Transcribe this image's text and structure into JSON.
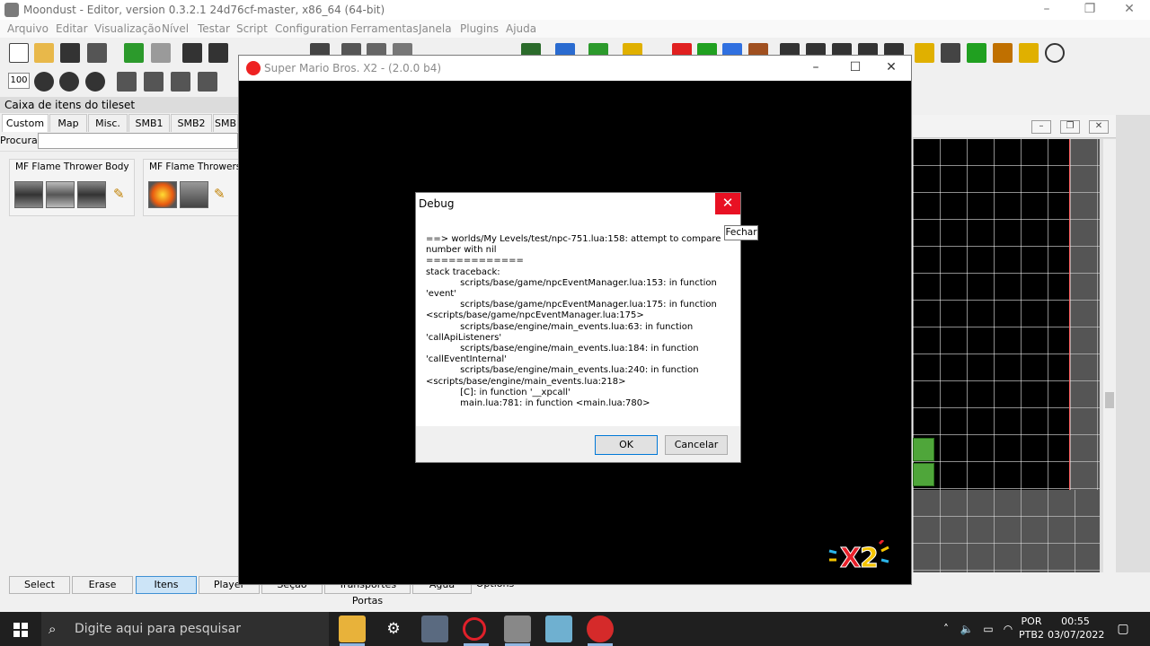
{
  "editor": {
    "title": "Moondust - Editor, version 0.3.2.1 24d76cf-master, x86_64 (64-bit)",
    "menu": [
      "Arquivo",
      "Editar",
      "Visualização",
      "Nível",
      "Testar",
      "Script",
      "Configuration",
      "Ferramentas",
      "Janela",
      "Plugins",
      "Ajuda"
    ],
    "zoom_value": "100",
    "tileset": {
      "title": "Caixa de itens do tileset",
      "tabs": [
        "Custom",
        "Map",
        "Misc.",
        "SMB1",
        "SMB2",
        "SMB"
      ],
      "search_label": "Procurar:",
      "search_value": "",
      "groups": [
        {
          "name": "MF Flame Thrower Body"
        },
        {
          "name": "MF Flame Throwers"
        }
      ]
    },
    "bottom_tabs": [
      "Select",
      "Erase",
      "Itens",
      "Player",
      "Seção",
      "Transportes  Portas",
      "Água",
      "Options"
    ]
  },
  "game_window": {
    "title": "Super Mario Bros. X2 - (2.0.0 b4)"
  },
  "debug_dialog": {
    "title": "Debug",
    "close_tooltip": "Fechar",
    "message": "==> worlds/My Levels/test/npc-751.lua:158: attempt to compare number with nil\n=============\nstack traceback:\n            scripts/base/game/npcEventManager.lua:153: in function 'event'\n            scripts/base/game/npcEventManager.lua:175: in function <scripts/base/game/npcEventManager.lua:175>\n            scripts/base/engine/main_events.lua:63: in function 'callApiListeners'\n            scripts/base/engine/main_events.lua:184: in function 'callEventInternal'\n            scripts/base/engine/main_events.lua:240: in function <scripts/base/engine/main_events.lua:218>\n            [C]: in function '__xpcall'\n            main.lua:781: in function <main.lua:780>",
    "ok_label": "OK",
    "cancel_label": "Cancelar"
  },
  "taskbar": {
    "search_placeholder": "Digite aqui para pesquisar",
    "lang_top": "POR",
    "lang_bottom": "PTB2",
    "time": "00:55",
    "date": "03/07/2022"
  }
}
